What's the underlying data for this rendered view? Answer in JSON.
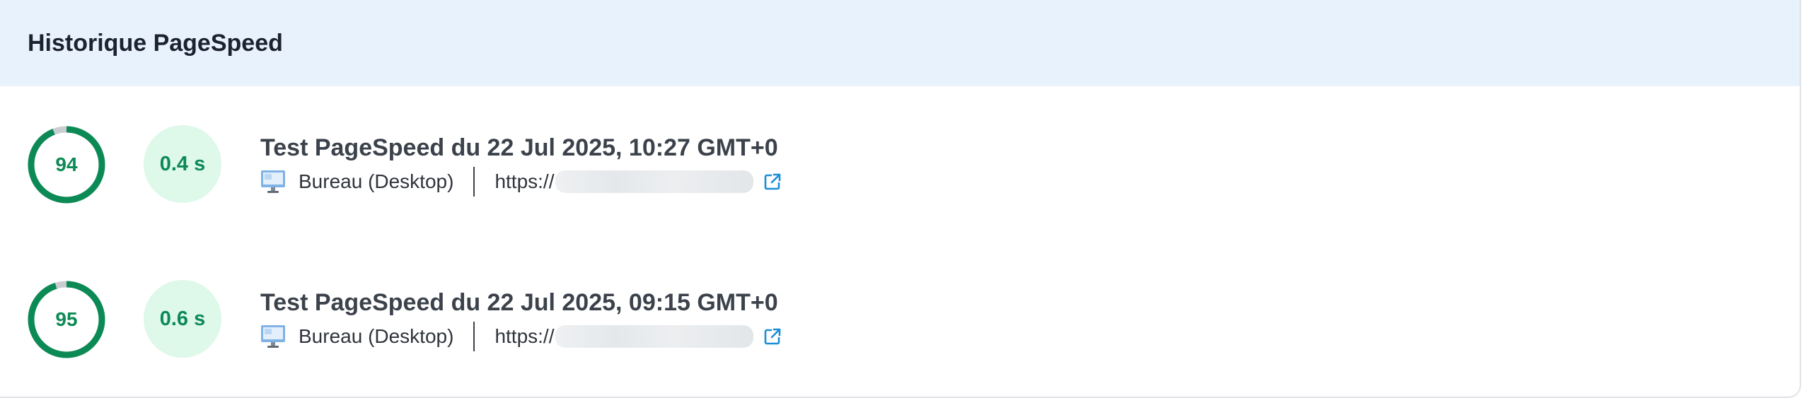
{
  "panel": {
    "title": "Historique PageSpeed"
  },
  "tests": [
    {
      "score": "94",
      "score_fraction": 0.94,
      "load_time": "0.4 s",
      "title": "Test PageSpeed du 22 Jul 2025, 10:27 GMT+0",
      "device": "Bureau (Desktop)",
      "url_prefix": "https://"
    },
    {
      "score": "95",
      "score_fraction": 0.95,
      "load_time": "0.6 s",
      "title": "Test PageSpeed du 22 Jul 2025, 09:15 GMT+0",
      "device": "Bureau (Desktop)",
      "url_prefix": "https://"
    }
  ],
  "colors": {
    "gauge_fill": "#0c8a55",
    "gauge_track": "#c9cdd1",
    "badge_bg": "#def8ea",
    "header_bg": "#e7f2fd",
    "link": "#1a8fd6"
  },
  "icons": {
    "device": "desktop-monitor-icon",
    "link": "external-link-icon"
  }
}
